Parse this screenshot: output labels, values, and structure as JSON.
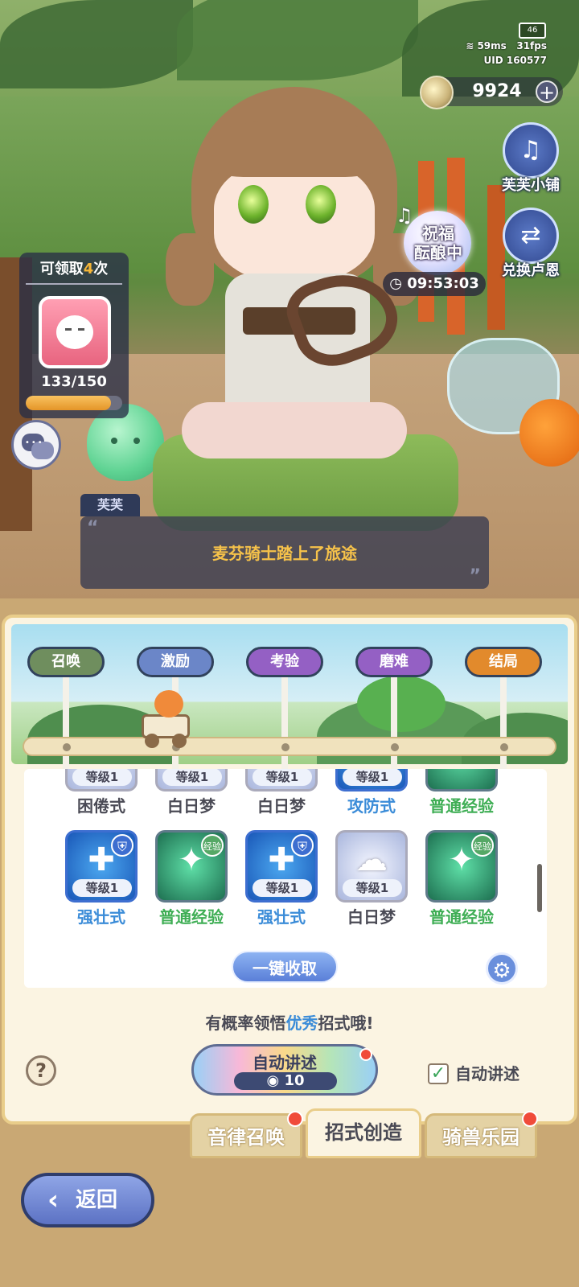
{
  "hud": {
    "battery": "46",
    "ping": "59ms",
    "fps": "31fps",
    "uid_label": "UID",
    "uid": "160577",
    "currency": "9924",
    "add_symbol": "+"
  },
  "side_buttons": {
    "shop_label": "芙芙小铺",
    "exchange_label": "兑换卢恩",
    "shop_icon": "harp-icon",
    "exchange_icon": "exchange-icon"
  },
  "blessing": {
    "label": "祝福\n酝酿中",
    "line1": "祝福",
    "line2": "酝酿中",
    "timer": "09:53:03"
  },
  "claim_card": {
    "prefix": "可领取",
    "count": "4",
    "suffix": "次",
    "progress_text": "133/150",
    "progress_fraction": 0.8867
  },
  "dialog": {
    "speaker": "芙芙",
    "text": "麦芬骑士踏上了旅途",
    "open_quote": "“",
    "close_quote": "”"
  },
  "stages": {
    "items": [
      {
        "label": "召唤",
        "color": "#6f8e5e"
      },
      {
        "label": "激励",
        "color": "#6b86c8"
      },
      {
        "label": "考验",
        "color": "#9460c4"
      },
      {
        "label": "磨难",
        "color": "#9460c4"
      },
      {
        "label": "结局",
        "color": "#e28a2c"
      }
    ]
  },
  "skills": {
    "row_top": [
      {
        "level": "等级1",
        "name": "困倦式",
        "color": "dark",
        "style": "white"
      },
      {
        "level": "等级1",
        "name": "白日梦",
        "color": "dark",
        "style": "white"
      },
      {
        "level": "等级1",
        "name": "白日梦",
        "color": "dark",
        "style": "white"
      },
      {
        "level": "等级1",
        "name": "攻防式",
        "color": "blue",
        "style": "blue"
      },
      {
        "level": "",
        "name": "普通经验",
        "color": "green",
        "style": "green"
      }
    ],
    "row_bottom": [
      {
        "level": "等级1",
        "name": "强壮式",
        "color": "blue",
        "style": "blue",
        "badge": "shield-icon"
      },
      {
        "level": "",
        "name": "普通经验",
        "color": "green",
        "style": "green",
        "badge_text": "经验"
      },
      {
        "level": "等级1",
        "name": "强壮式",
        "color": "blue",
        "style": "blue",
        "badge": "shield-icon"
      },
      {
        "level": "等级1",
        "name": "白日梦",
        "color": "dark",
        "style": "white"
      },
      {
        "level": "",
        "name": "普通经验",
        "color": "green",
        "style": "green",
        "badge_text": "经验"
      }
    ]
  },
  "actions": {
    "claim_all": "一键收取",
    "hint_prefix": "有概率领悟",
    "hint_emphasis": "优秀",
    "hint_suffix": "招式哦!",
    "auto_narrate": "自动讲述",
    "auto_cost": "10",
    "auto_checkbox_label": "自动讲述",
    "auto_checked": true,
    "help": "?"
  },
  "tabs": [
    {
      "label": "音律召唤",
      "active": false,
      "dot": true
    },
    {
      "label": "招式创造",
      "active": true,
      "dot": false
    },
    {
      "label": "骑兽乐园",
      "active": false,
      "dot": true
    }
  ],
  "back": {
    "label": "返回"
  }
}
